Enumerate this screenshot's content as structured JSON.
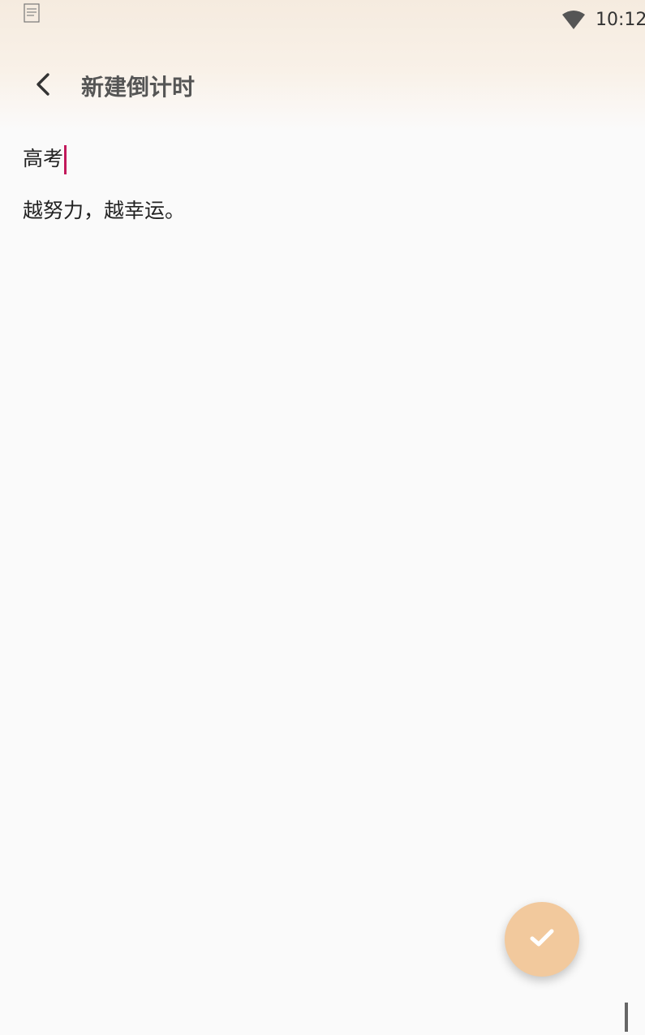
{
  "status_bar": {
    "time": "10:12",
    "icons": [
      "notification-icon",
      "wifi-icon"
    ]
  },
  "toolbar": {
    "back_icon": "back-arrow-icon",
    "title": "新建倒计时"
  },
  "form": {
    "title_value": "高考",
    "subtitle_value": "越努力，越幸运。"
  },
  "fab": {
    "icon": "check-icon"
  },
  "colors": {
    "header_gradient_top": "#f5ebdf",
    "background": "#fafafa",
    "fab": "#f2c99d",
    "caret": "#c2185b",
    "title_text": "#555555"
  }
}
